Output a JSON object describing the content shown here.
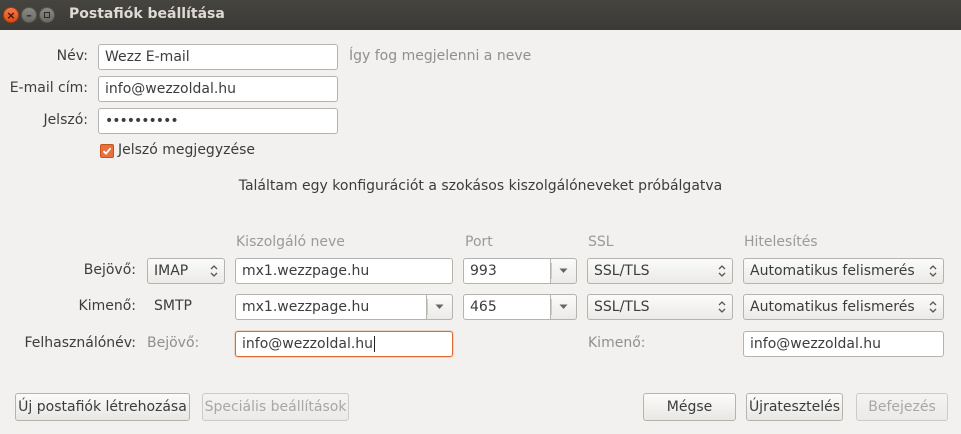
{
  "window": {
    "title": "Postafiók beállítása"
  },
  "form": {
    "name_label": "Név:",
    "name_value": "Wezz E-mail",
    "name_hint": "Így fog megjelenni a neve",
    "email_label": "E-mail cím:",
    "email_value": "info@wezzoldal.hu",
    "password_label": "Jelszó:",
    "password_value": "••••••••••",
    "remember_label": "Jelszó megjegyzése",
    "remember_checked": true
  },
  "status_message": "Találtam egy konfigurációt a szokásos kiszolgálóneveket próbálgatva",
  "server_table": {
    "headers": {
      "hostname": "Kiszolgáló neve",
      "port": "Port",
      "ssl": "SSL",
      "auth": "Hitelesítés"
    },
    "incoming": {
      "label": "Bejövő:",
      "protocol": "IMAP",
      "hostname": "mx1.wezzpage.hu",
      "port": "993",
      "ssl": "SSL/TLS",
      "auth": "Automatikus felismerés"
    },
    "outgoing": {
      "label": "Kimenő:",
      "protocol": "SMTP",
      "hostname": "mx1.wezzpage.hu",
      "port": "465",
      "ssl": "SSL/TLS",
      "auth": "Automatikus felismerés"
    },
    "username": {
      "label": "Felhasználónév:",
      "incoming_label": "Bejövő:",
      "incoming_value": "info@wezzoldal.hu",
      "outgoing_label": "Kimenő:",
      "outgoing_value": "info@wezzoldal.hu"
    }
  },
  "buttons": {
    "new_account": "Új postafiók létrehozása",
    "advanced": "Speciális beállítások",
    "cancel": "Mégse",
    "retest": "Újratesztelés",
    "done": "Befejezés"
  },
  "colors": {
    "accent": "#e9703a",
    "titlebar": "#3c3b37"
  }
}
